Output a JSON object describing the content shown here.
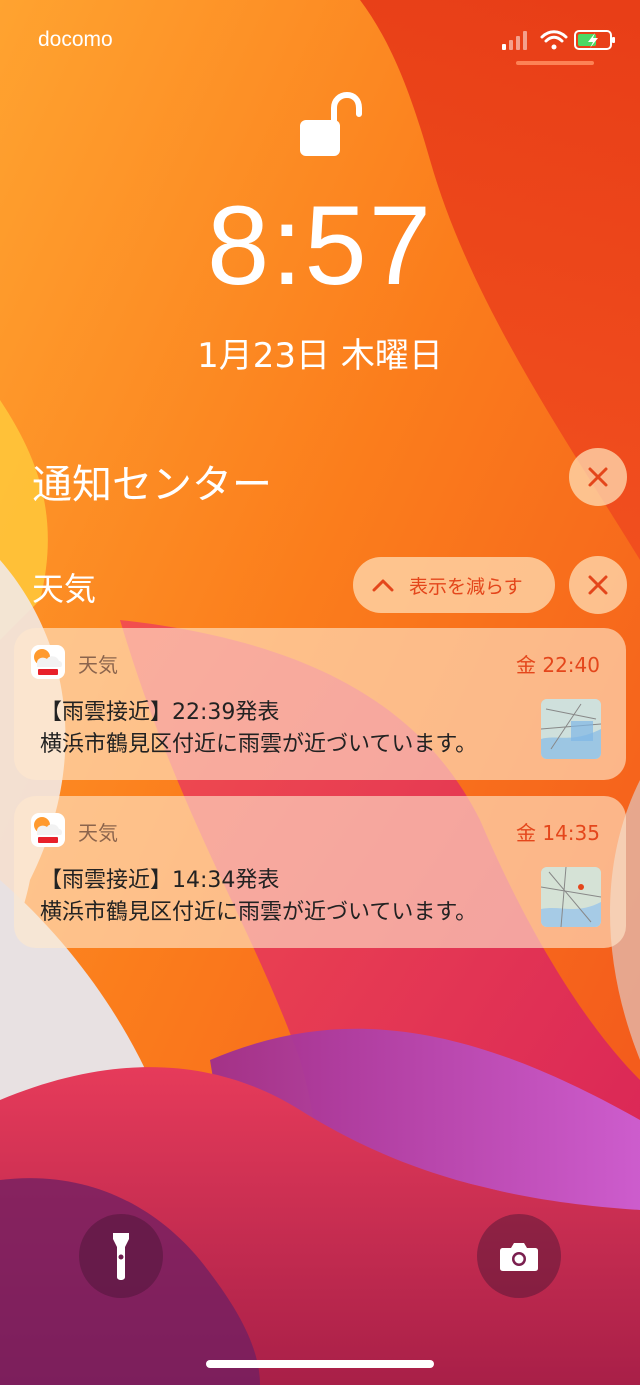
{
  "status_bar": {
    "carrier": "docomo",
    "signal_icon": "cellular-signal-icon",
    "wifi_icon": "wifi-icon",
    "battery_icon": "battery-charging-icon"
  },
  "lock_screen": {
    "lock_icon": "unlocked-padlock-icon",
    "time": "8:57",
    "date": "1月23日 木曜日"
  },
  "notification_center": {
    "title": "通知センター",
    "clear_icon": "close-icon"
  },
  "group": {
    "title": "天気",
    "show_less_label": "表示を減らす",
    "show_less_icon": "chevron-up-icon",
    "clear_icon": "close-icon"
  },
  "notifications": [
    {
      "app_name": "天気",
      "time": "金 22:40",
      "title": "【雨雲接近】22:39発表",
      "body": "横浜市鶴見区付近に雨雲が近づいています。",
      "thumbnail": "rain-map-thumbnail"
    },
    {
      "app_name": "天気",
      "time": "金 14:35",
      "title": "【雨雲接近】14:34発表",
      "body": "横浜市鶴見区付近に雨雲が近づいています。",
      "thumbnail": "rain-map-thumbnail"
    }
  ],
  "bottom": {
    "flashlight_icon": "flashlight-icon",
    "camera_icon": "camera-icon"
  },
  "colors": {
    "accent": "#e4461b",
    "wallpaper_orange": "#f97b1a",
    "wallpaper_red": "#e52a1a",
    "wallpaper_pink": "#e62f63",
    "wallpaper_purple": "#c25ad0"
  }
}
